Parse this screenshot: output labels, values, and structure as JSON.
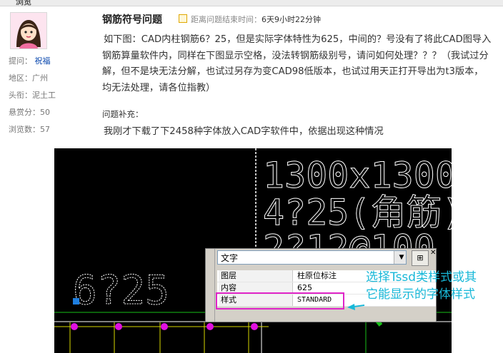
{
  "header": {
    "partial_label": "浏览"
  },
  "user": {
    "asker_label": "提问：",
    "asker_name": "祝福",
    "region": "地区：广州",
    "rank": "头衔：泥土工",
    "reward": "悬赏分：50",
    "views": "浏览数：57"
  },
  "question": {
    "title": "钢筋符号问题",
    "timer_label": "距离问题结束时间：",
    "timer_value": "6天9小时22分钟",
    "body": "如下图：CAD内柱钢筋6？25，但是实际字体特性为625，中间的？号没有了将此CAD图导入钢筋算量软件内，同样在下图显示空格，没法转钢筋级别号，请问如何处理？？？（我试过分解，但不是块无法分解，也试过另存为变CAD98低版本，也试过用天正打开导出为t3版本，均无法处理，请各位指教）",
    "supplement_label": "问题补充：",
    "supplement": "我刚才下载了下2458种字体放入CAD字软件中，依据出现这种情况"
  },
  "cad": {
    "text_line1": "1300x1300",
    "text_line2": "4?25(角筋)",
    "text_line3": "2?12@100",
    "text_rebar": "6?25",
    "colors": {
      "background": "#000000",
      "text": "#ffffff",
      "magenta": "#e010e0",
      "green": "#18c018",
      "yellow": "#d8d800"
    }
  },
  "properties": {
    "dropdown_value": "文字",
    "rows": [
      {
        "key": "图层",
        "value": "柱原位标注"
      },
      {
        "key": "内容",
        "value": "625"
      },
      {
        "key": "样式",
        "value": "STANDARD"
      }
    ],
    "close_glyph": "✕"
  },
  "annotation": {
    "line1": "选择Tssd类样式或其",
    "line2": "它能显示的字体样式"
  }
}
